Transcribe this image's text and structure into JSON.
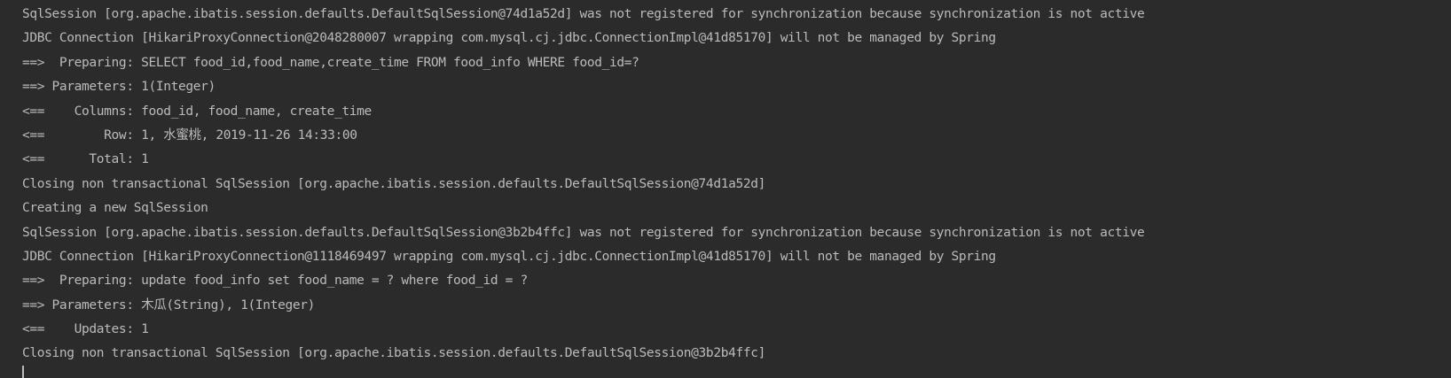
{
  "console": {
    "lines": [
      "SqlSession [org.apache.ibatis.session.defaults.DefaultSqlSession@74d1a52d] was not registered for synchronization because synchronization is not active",
      "JDBC Connection [HikariProxyConnection@2048280007 wrapping com.mysql.cj.jdbc.ConnectionImpl@41d85170] will not be managed by Spring",
      "==>  Preparing: SELECT food_id,food_name,create_time FROM food_info WHERE food_id=?",
      "==> Parameters: 1(Integer)",
      "<==    Columns: food_id, food_name, create_time",
      "<==        Row: 1, 水蜜桃, 2019-11-26 14:33:00",
      "<==      Total: 1",
      "Closing non transactional SqlSession [org.apache.ibatis.session.defaults.DefaultSqlSession@74d1a52d]",
      "Creating a new SqlSession",
      "SqlSession [org.apache.ibatis.session.defaults.DefaultSqlSession@3b2b4ffc] was not registered for synchronization because synchronization is not active",
      "JDBC Connection [HikariProxyConnection@1118469497 wrapping com.mysql.cj.jdbc.ConnectionImpl@41d85170] will not be managed by Spring",
      "==>  Preparing: update food_info set food_name = ? where food_id = ?",
      "==> Parameters: 木瓜(String), 1(Integer)",
      "<==    Updates: 1",
      "Closing non transactional SqlSession [org.apache.ibatis.session.defaults.DefaultSqlSession@3b2b4ffc]"
    ]
  },
  "colors": {
    "background": "#2b2b2b",
    "text": "#bbbbbb"
  }
}
